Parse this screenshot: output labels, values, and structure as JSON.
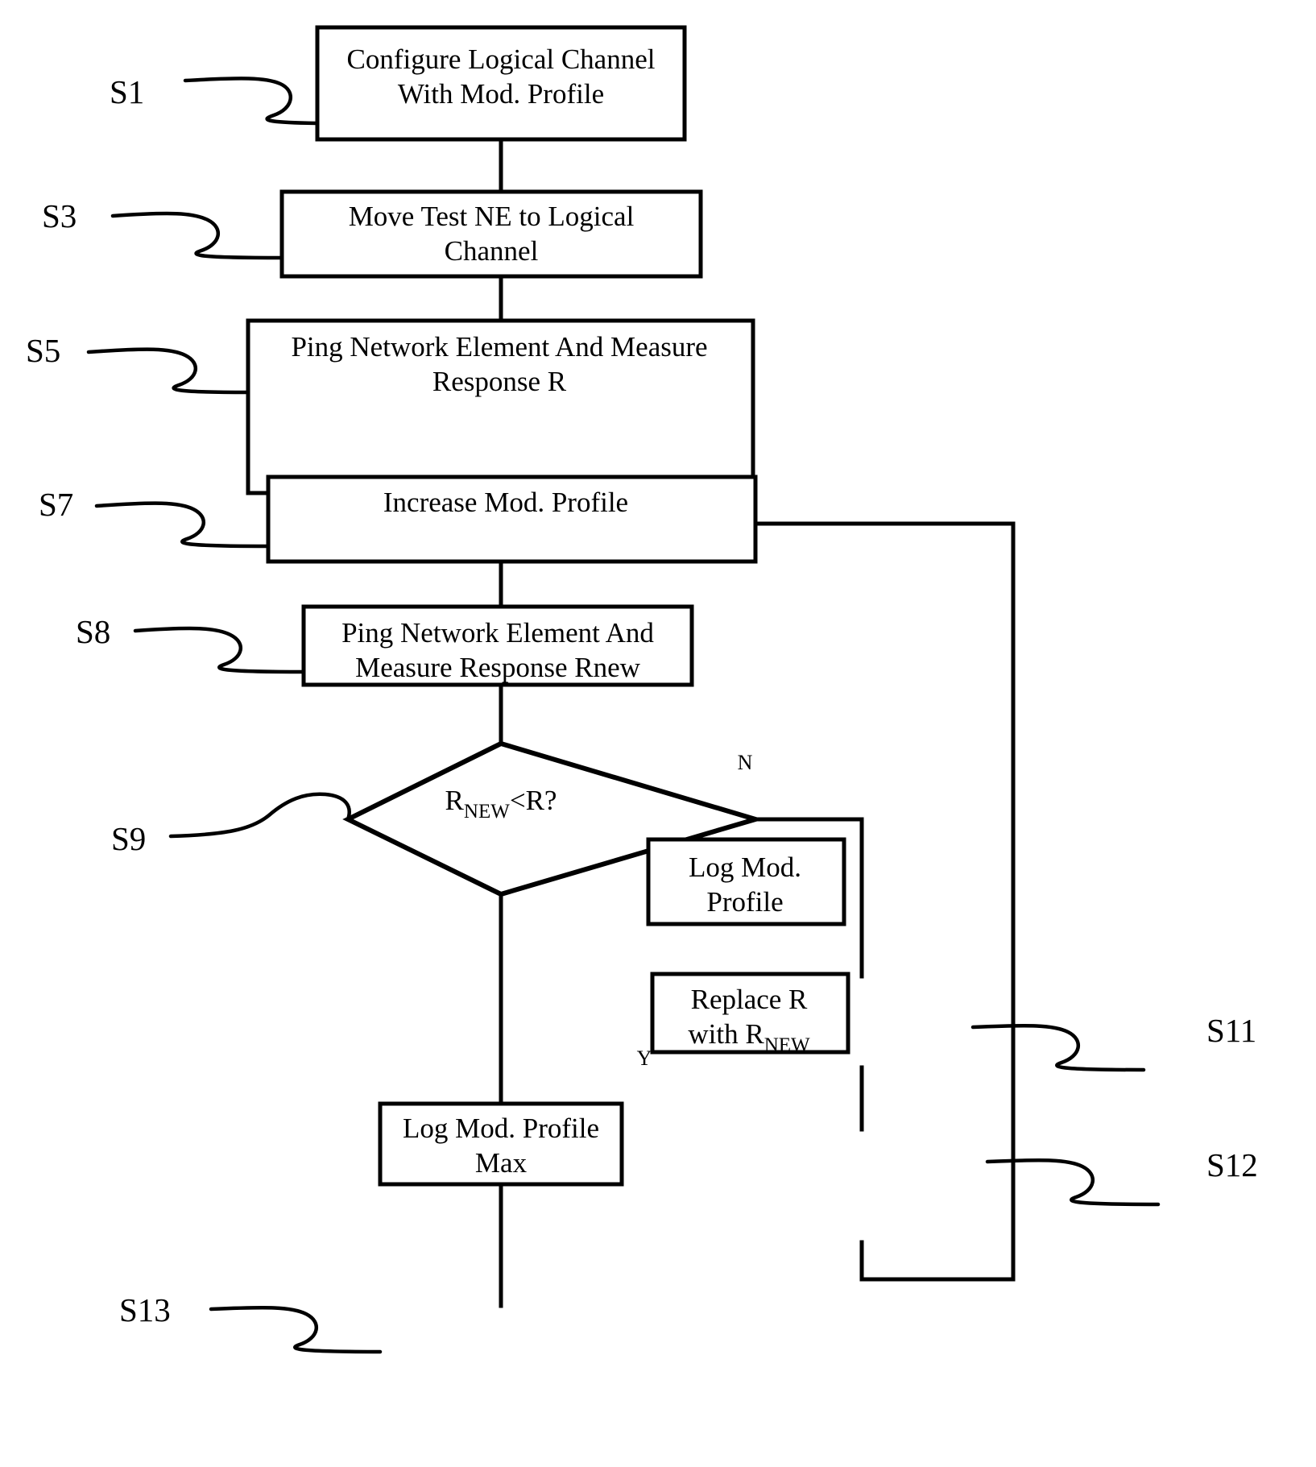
{
  "figure": {
    "type": "flowchart",
    "title": "Modulation Profile Test Flowchart",
    "background_color": "#ffffff",
    "line_color": "#000000"
  },
  "nodes": [
    {
      "id": "s1",
      "step": "S1",
      "shape": "process",
      "lines": [
        "Configure Logical Channel",
        "With Mod. Profile"
      ],
      "text": "Configure Logical Channel With Mod. Profile"
    },
    {
      "id": "s3",
      "step": "S3",
      "shape": "process",
      "lines": [
        "Move Test NE to Logical",
        "Channel"
      ],
      "text": "Move Test NE to Logical Channel"
    },
    {
      "id": "s5",
      "step": "S5",
      "shape": "process",
      "lines": [
        "Ping Network Element And Measure",
        "Response R"
      ],
      "text": "Ping Network Element And Measure Response R"
    },
    {
      "id": "s7",
      "step": "S7",
      "shape": "process",
      "lines": [
        "Increase Mod. Profile"
      ],
      "text": "Increase Mod. Profile"
    },
    {
      "id": "s8",
      "step": "S8",
      "shape": "process",
      "lines": [
        "Ping Network Element And",
        "Measure Response Rnew"
      ],
      "text": "Ping Network Element And Measure Response Rnew"
    },
    {
      "id": "s9",
      "step": "S9",
      "shape": "decision",
      "lines": [
        "R",
        "NEW",
        "<R?"
      ],
      "text_main": "R",
      "text_subscript": "NEW",
      "text_tail": "<R?",
      "text": "RNEW<R?"
    },
    {
      "id": "s11",
      "step": "S11",
      "shape": "process",
      "lines": [
        "Log Mod.",
        "Profile"
      ],
      "text": "Log Mod. Profile"
    },
    {
      "id": "s12",
      "step": "S12",
      "shape": "process",
      "lines": [
        "Replace R",
        "with R",
        "NEW"
      ],
      "line1": "Replace R",
      "line2_main": "with R",
      "line2_subscript": "NEW",
      "text": "Replace R with RNEW"
    },
    {
      "id": "s13",
      "step": "S13",
      "shape": "process",
      "lines": [
        "Log Mod. Profile",
        "Max"
      ],
      "text": "Log Mod. Profile Max"
    }
  ],
  "branch_labels": {
    "no": "N",
    "yes": "Y"
  },
  "step_labels": {
    "s1": "S1",
    "s3": "S3",
    "s5": "S5",
    "s7": "S7",
    "s8": "S8",
    "s9": "S9",
    "s11": "S11",
    "s12": "S12",
    "s13": "S13"
  }
}
